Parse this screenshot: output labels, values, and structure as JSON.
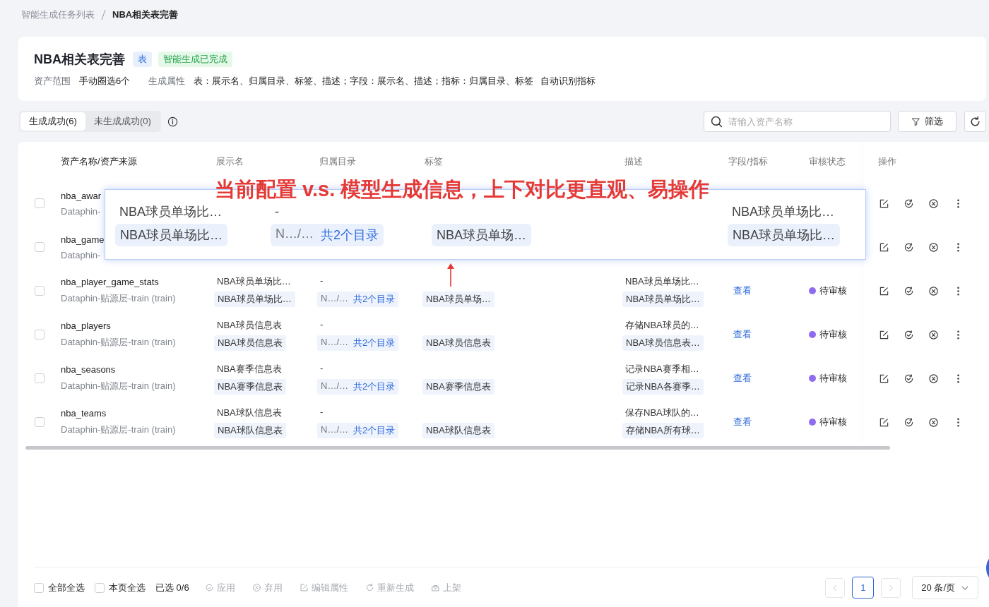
{
  "breadcrumb": {
    "parent": "智能生成任务列表",
    "current": "NBA相关表完善"
  },
  "header": {
    "title": "NBA相关表完善",
    "type_tag": "表",
    "status_tag": "智能生成已完成",
    "meta": [
      {
        "label": "资产范围",
        "value": "手动圈选6个"
      },
      {
        "label": "生成属性",
        "value": "表：展示名、归属目录、标签、描述；字段：展示名、描述；指标：归属目录、标签"
      }
    ],
    "extra": "自动识别指标"
  },
  "tabs": [
    {
      "label": "生成成功(6)",
      "selected": true
    },
    {
      "label": "未生成成功(0)",
      "selected": false
    }
  ],
  "search": {
    "placeholder": "请输入资产名称"
  },
  "filter_button": "筛选",
  "table": {
    "columns": [
      "资产名称/资产来源",
      "展示名",
      "归属目录",
      "标签",
      "描述",
      "字段/指标",
      "审核状态",
      "操作"
    ],
    "rows": [
      {
        "checked": false,
        "name": "nba_awar",
        "source": "Dataphin-"
      },
      {
        "checked": false,
        "name": "nba_game",
        "source": "Dataphin-"
      },
      {
        "checked": false,
        "name": "nba_player_game_stats",
        "source": "Dataphin-贴源层-train (train)",
        "display_current": "NBA球员单场比…",
        "display_generated": "NBA球员单场比…",
        "dir_current": "-",
        "dir_generated": "N…/…",
        "dir_link": "共2个目录",
        "tag_generated": "NBA球员单场…",
        "desc_current": "NBA球员单场比…",
        "desc_generated": "NBA球员单场比…",
        "field_link": "查看",
        "status": "待审核"
      },
      {
        "checked": false,
        "name": "nba_players",
        "source": "Dataphin-贴源层-train (train)",
        "display_current": "NBA球员信息表",
        "display_generated": "NBA球员信息表",
        "dir_current": "-",
        "dir_generated": "N…/…",
        "dir_link": "共2个目录",
        "tag_generated": "NBA球员信息表",
        "desc_current": "存储NBA球员的…",
        "desc_generated": "NBA球员信息表…",
        "field_link": "查看",
        "status": "待审核"
      },
      {
        "checked": false,
        "name": "nba_seasons",
        "source": "Dataphin-贴源层-train (train)",
        "display_current": "NBA赛季信息表",
        "display_generated": "NBA赛季信息表",
        "dir_current": "-",
        "dir_generated": "N…/…",
        "dir_link": "共2个目录",
        "tag_generated": "NBA赛季信息表",
        "desc_current": "记录NBA赛季相…",
        "desc_generated": "记录NBA各赛季…",
        "field_link": "查看",
        "status": "待审核"
      },
      {
        "checked": false,
        "name": "nba_teams",
        "source": "Dataphin-贴源层-train (train)",
        "display_current": "NBA球队信息表",
        "display_generated": "NBA球队信息表",
        "dir_current": "-",
        "dir_generated": "N…/…",
        "dir_link": "共2个目录",
        "tag_generated": "NBA球队信息表",
        "desc_current": "保存NBA球队的…",
        "desc_generated": "存储NBA所有球…",
        "field_link": "查看",
        "status": "待审核"
      }
    ]
  },
  "callout": {
    "current": {
      "display": "NBA球员单场比…",
      "directory": "-",
      "description": "NBA球员单场比…"
    },
    "generated": {
      "display": "NBA球员单场比…",
      "directory": "N…/…",
      "directory_link": "共2个目录",
      "tag": "NBA球员单场…",
      "description": "NBA球员单场比…"
    }
  },
  "annotation": "当前配置 v.s. 模型生成信息，上下对比更直观、易操作",
  "footer": {
    "select_all": {
      "label": "全部全选",
      "checked": false
    },
    "page_select": {
      "label": "本页全选",
      "checked": false
    },
    "selected_count": "已选 0/6",
    "actions": [
      {
        "kind": "apply",
        "label": "应用",
        "disabled": true
      },
      {
        "kind": "discard",
        "label": "弃用",
        "disabled": true
      },
      {
        "kind": "edit",
        "label": "编辑属性",
        "disabled": true
      },
      {
        "kind": "regenerate",
        "label": "重新生成",
        "disabled": true
      },
      {
        "kind": "publish",
        "label": "上架",
        "disabled": true
      }
    ],
    "pages": [
      {
        "label": "1",
        "selected": true
      }
    ],
    "page_size": "20 条/页"
  }
}
